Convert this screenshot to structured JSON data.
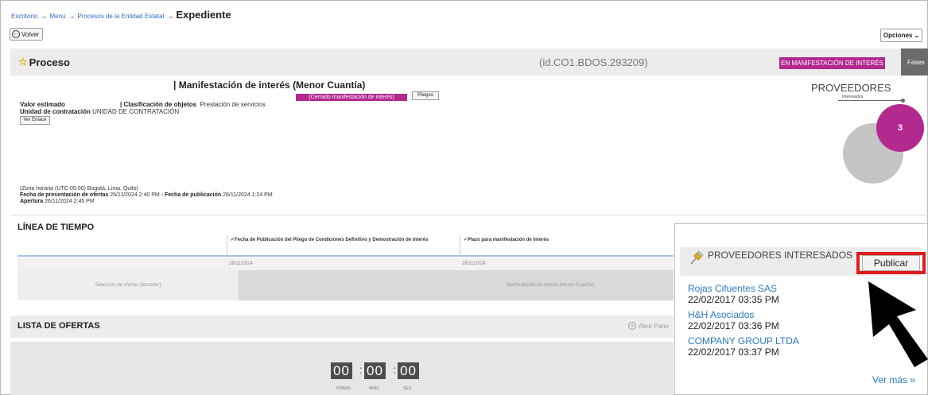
{
  "breadcrumb": {
    "items": [
      "Escritorio",
      "Menú",
      "Procesos de la Entidad Estatal"
    ],
    "separator": "→",
    "current": "Expediente"
  },
  "toolbar": {
    "back_label": "Volver",
    "options_label": "Opciones"
  },
  "process": {
    "header_title": "Proceso",
    "id": "(id.CO1.BDOS.293209)",
    "status": "EN MANIFESTACIÓN DE INTERÉS",
    "phases_label": "Fases",
    "name": "| Manifestación de interés (Menor Cuantía)",
    "closed_tag": "(Cerrado manifestación de interés)",
    "pliegos_label": "Pliegos",
    "valor_estimado_label": "Valor estimado",
    "clasificacion_label": "| Clasificación de objetos",
    "clasificacion_value": "Prestación de servicios",
    "unidad_label": "Unidad de contratación",
    "unidad_value": "UNIDAD DE CONTRATACIÓN",
    "ver_enlace_label": "Ver Enlace",
    "timezone": "(Zona horaria (UTC-05:00) Bogotá, Lima, Quito)",
    "presentacion_label": "Fecha de presentación de ofertas",
    "presentacion_value": "26/11/2024 2:40 PM",
    "dash": " - ",
    "publicacion_label": "Fecha de publicación",
    "publicacion_value": "26/11/2024 1:24 PM",
    "apertura_label": "Apertura",
    "apertura_value": "26/11/2024 2:45 PM"
  },
  "providers_chart": {
    "title": "PROVEEDORES",
    "subtitle": "Interesados",
    "count": "3",
    "colors": {
      "highlight": "#b32990",
      "base": "#c4c4c4"
    }
  },
  "timeline": {
    "title": "LÍNEA DE TIEMPO",
    "columns": [
      "Fecha de Publicación del Pliego de Condiciones Definitivo y Demostración de Interés",
      "Plazo para manifestación de Interés"
    ],
    "dates": [
      "26/11/2024",
      "26/11/2024"
    ],
    "phases": [
      "Selección de ofertas (borrador)",
      "Manifestación de interés (Menor Cuantía)"
    ]
  },
  "offers": {
    "title": "LISTA DE OFERTAS",
    "open_panel_label": "Abrir Pane",
    "countdown": {
      "hours": "00",
      "mins": "00",
      "secs": "00"
    },
    "countdown_labels": {
      "hours": "HORAS",
      "mins": "MINS",
      "secs": "SEG"
    }
  },
  "interested_panel": {
    "title": "PROVEEDORES INTERESADOS",
    "publish_label": "Publicar",
    "providers": [
      {
        "name": "Rojas Cifuentes SAS",
        "date": "22/02/2017 03:35 PM"
      },
      {
        "name": "H&H Asociados",
        "date": "22/02/2017 03:36 PM"
      },
      {
        "name": "COMPANY GROUP LTDA",
        "date": "22/02/2017 03:37 PM"
      }
    ],
    "more_label": "Ver más »"
  },
  "colors": {
    "accent": "#b32990",
    "link": "#2b7bc4",
    "highlight_frame": "#e01b1b"
  }
}
